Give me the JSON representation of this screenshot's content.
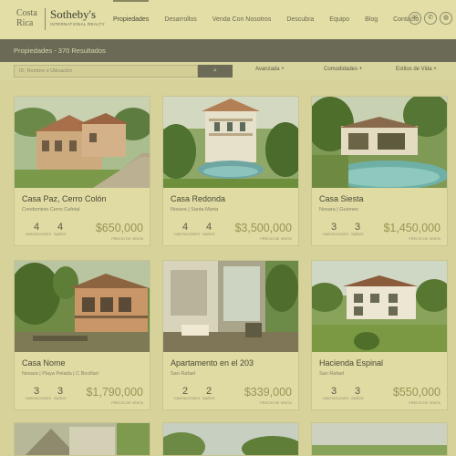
{
  "header": {
    "logo_left_top": "Costa",
    "logo_left_bottom": "Rica",
    "logo_brand": "Sotheby's",
    "logo_sub": "INTERNATIONAL REALTY",
    "nav": [
      "Propiedades",
      "Desarrollos",
      "Venda Con Nosotros",
      "Descubra",
      "Equipo",
      "Blog",
      "Contacto"
    ],
    "icons": [
      "mail-icon",
      "phone-icon",
      "globe-icon"
    ]
  },
  "results": {
    "text": "Propiedades - 370 Resultados"
  },
  "search": {
    "placeholder": "ID, Nombre o Ubicación",
    "button_icon": "search-icon",
    "filters": [
      "Avanzada +",
      "Comodidades +",
      "Estilos de Vida +"
    ]
  },
  "listings": [
    {
      "title": "Casa Paz, Cerro Colón",
      "location": "Condominio Cerro Cafetal",
      "beds": "4",
      "baths": "4",
      "beds_label": "HABITACIONES",
      "baths_label": "BAÑOS",
      "price": "$650,000",
      "price_label": "PRECIO DE VENTA"
    },
    {
      "title": "Casa Redonda",
      "location": "Nosara | Santa Marta",
      "beds": "4",
      "baths": "4",
      "beds_label": "HABITACIONES",
      "baths_label": "BAÑOS",
      "price": "$3,500,000",
      "price_label": "PRECIO DE VENTA"
    },
    {
      "title": "Casa Siesta",
      "location": "Nosara | Guiones",
      "beds": "3",
      "baths": "3",
      "beds_label": "HABITACIONES",
      "baths_label": "BAÑOS",
      "price": "$1,450,000",
      "price_label": "PRECIO DE VENTA"
    },
    {
      "title": "Casa Nome",
      "location": "Nosara | Playa Pelada | C Bocillari",
      "beds": "3",
      "baths": "3",
      "beds_label": "HABITACIONES",
      "baths_label": "BAÑOS",
      "price": "$1,790,000",
      "price_label": "PRECIO DE VENTA"
    },
    {
      "title": "Apartamento en el 203",
      "location": "San Rafael",
      "beds": "2",
      "baths": "2",
      "beds_label": "HABITACIONES",
      "baths_label": "BAÑOS",
      "price": "$339,000",
      "price_label": "PRECIO DE VENTA"
    },
    {
      "title": "Hacienda Espinal",
      "location": "San Rafael",
      "beds": "3",
      "baths": "3",
      "beds_label": "HABITACIONES",
      "baths_label": "BAÑOS",
      "price": "$550,000",
      "price_label": "PRECIO DE VENTA"
    }
  ]
}
